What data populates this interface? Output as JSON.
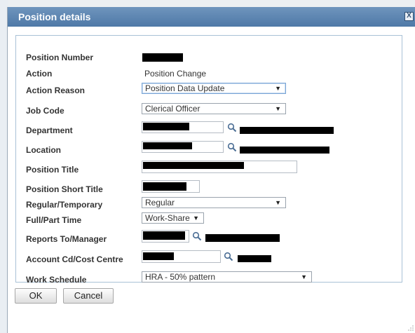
{
  "dialog": {
    "title": "Position details",
    "close_icon": "close-icon",
    "close_glyph": "X"
  },
  "fields": {
    "position_number": {
      "label": "Position Number"
    },
    "action": {
      "label": "Action",
      "value": "Position Change"
    },
    "action_reason": {
      "label": "Action Reason",
      "value": "Position Data Update"
    },
    "job_code": {
      "label": "Job Code",
      "value": "Clerical Officer"
    },
    "department": {
      "label": "Department"
    },
    "location": {
      "label": "Location"
    },
    "position_title": {
      "label": "Position Title"
    },
    "position_short_title": {
      "label": "Position Short Title"
    },
    "regular_temporary": {
      "label": "Regular/Temporary",
      "value": "Regular"
    },
    "full_part_time": {
      "label": "Full/Part Time",
      "value": "Work-Share"
    },
    "reports_to": {
      "label": "Reports To/Manager"
    },
    "account_cd": {
      "label": "Account Cd/Cost Centre"
    },
    "work_schedule": {
      "label": "Work Schedule",
      "value": "HRA - 50% pattern"
    }
  },
  "buttons": {
    "ok": "OK",
    "cancel": "Cancel"
  },
  "icons": {
    "lookup": "magnifier-icon",
    "dropdown": "chevron-down-icon",
    "dropdown_glyph": "▼"
  },
  "colors": {
    "title_bar": "#4e79a7",
    "panel_border": "#a9c1d6",
    "focus_border": "#7aa5d6"
  }
}
